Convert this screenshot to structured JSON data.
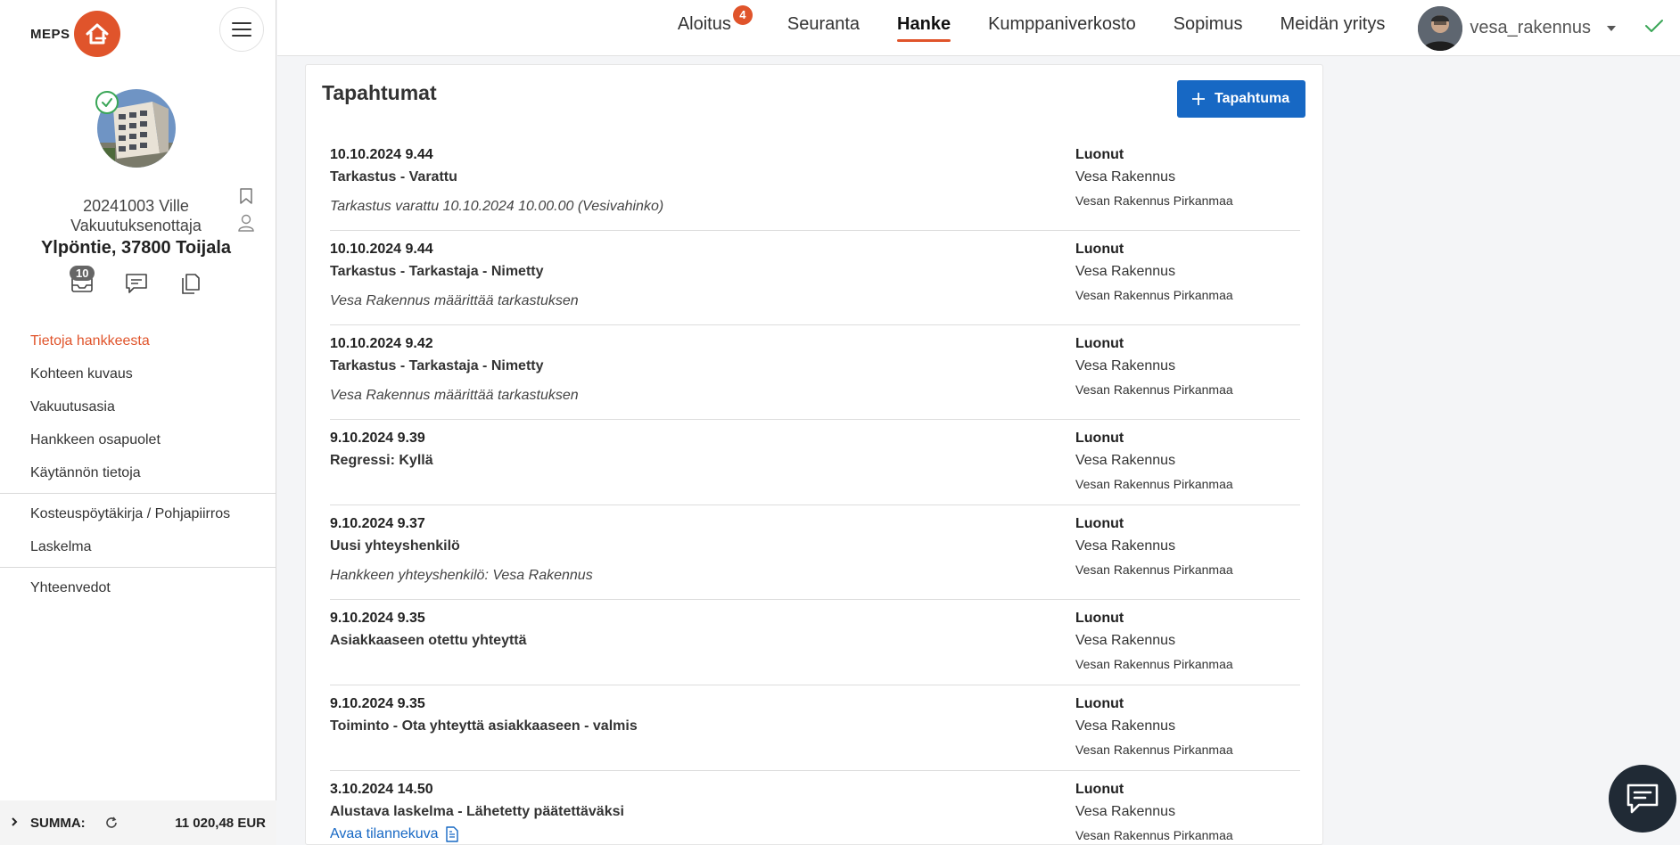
{
  "app": {
    "logo_text": "MEPS"
  },
  "colors": {
    "accent": "#e0542b",
    "primary": "#1768c4",
    "success": "#3aa657"
  },
  "sidebar": {
    "project_line1": "20241003 Ville",
    "project_line2": "Vakuutuksenottaja",
    "project_address": "Ylpöntie, 37800 Toijala",
    "tool_badge": "10",
    "nav_group1": [
      {
        "label": "Tietoja hankkeesta",
        "active": true
      },
      {
        "label": "Kohteen kuvaus"
      },
      {
        "label": "Vakuutusasia"
      },
      {
        "label": "Hankkeen osapuolet"
      },
      {
        "label": "Käytännön tietoja"
      }
    ],
    "nav_group2": [
      {
        "label": "Kosteuspöytäkirja / Pohjapiirros"
      },
      {
        "label": "Laskelma"
      }
    ],
    "nav_group3": [
      {
        "label": "Yhteenvedot"
      }
    ],
    "sum_label": "SUMMA:",
    "sum_value": "11 020,48 EUR"
  },
  "topnav": {
    "items": [
      {
        "label": "Aloitus",
        "badge": "4"
      },
      {
        "label": "Seuranta"
      },
      {
        "label": "Hanke",
        "active": true
      },
      {
        "label": "Kumppaniverkosto"
      },
      {
        "label": "Sopimus"
      },
      {
        "label": "Meidän yritys"
      }
    ],
    "username": "vesa_rakennus"
  },
  "main": {
    "title": "Tapahtumat",
    "add_button": "Tapahtuma",
    "events": [
      {
        "date": "10.10.2024 9.44",
        "title": "Tarkastus - Varattu",
        "desc": "Tarkastus varattu 10.10.2024 10.00.00 (Vesivahinko)",
        "rlabel": "Luonut",
        "rname": "Vesa Rakennus",
        "rorg": "Vesan Rakennus Pirkanmaa"
      },
      {
        "date": "10.10.2024 9.44",
        "title": "Tarkastus - Tarkastaja - Nimetty",
        "desc": "Vesa Rakennus määrittää tarkastuksen",
        "rlabel": "Luonut",
        "rname": "Vesa Rakennus",
        "rorg": "Vesan Rakennus Pirkanmaa"
      },
      {
        "date": "10.10.2024 9.42",
        "title": "Tarkastus - Tarkastaja - Nimetty",
        "desc": "Vesa Rakennus määrittää tarkastuksen",
        "rlabel": "Luonut",
        "rname": "Vesa Rakennus",
        "rorg": "Vesan Rakennus Pirkanmaa"
      },
      {
        "date": "9.10.2024 9.39",
        "title": "Regressi: Kyllä",
        "desc": "",
        "rlabel": "Luonut",
        "rname": "Vesa Rakennus",
        "rorg": "Vesan Rakennus Pirkanmaa"
      },
      {
        "date": "9.10.2024 9.37",
        "title": "Uusi yhteyshenkilö",
        "desc": "Hankkeen yhteyshenkilö: Vesa Rakennus",
        "rlabel": "Luonut",
        "rname": "Vesa Rakennus",
        "rorg": "Vesan Rakennus Pirkanmaa"
      },
      {
        "date": "9.10.2024 9.35",
        "title": "Asiakkaaseen otettu yhteyttä",
        "desc": "",
        "rlabel": "Luonut",
        "rname": "Vesa Rakennus",
        "rorg": "Vesan Rakennus Pirkanmaa"
      },
      {
        "date": "9.10.2024 9.35",
        "title": "Toiminto - Ota yhteyttä asiakkaaseen - valmis",
        "desc": "",
        "rlabel": "Luonut",
        "rname": "Vesa Rakennus",
        "rorg": "Vesan Rakennus Pirkanmaa"
      },
      {
        "date": "3.10.2024 14.50",
        "title": "Alustava laskelma - Lähetetty päätettäväksi",
        "link": "Avaa tilannekuva",
        "rlabel": "Luonut",
        "rname": "Vesa Rakennus",
        "rorg": "Vesan Rakennus Pirkanmaa"
      }
    ]
  }
}
